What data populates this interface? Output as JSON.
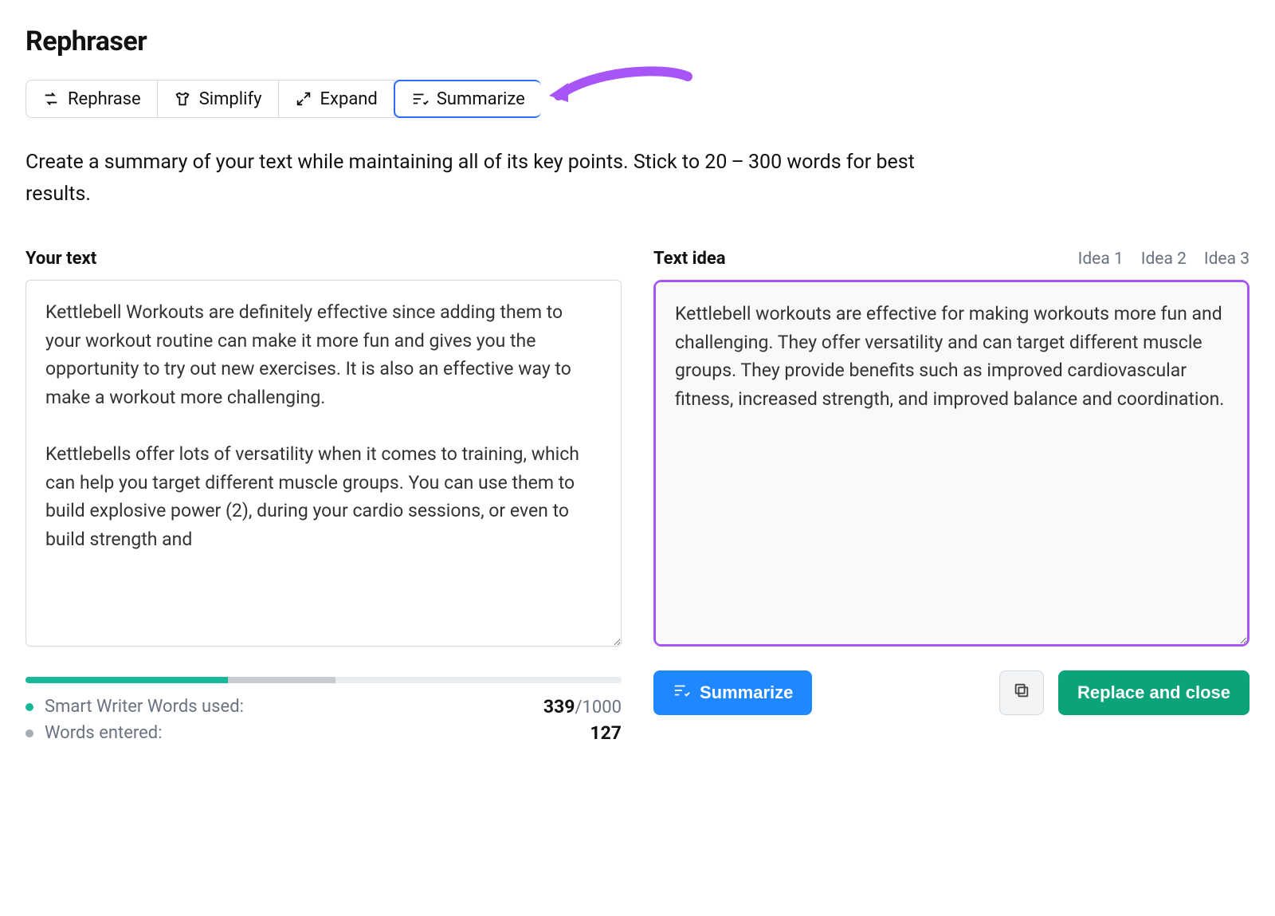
{
  "title": "Rephraser",
  "tabs": [
    {
      "label": "Rephrase",
      "icon": "rephrase-icon"
    },
    {
      "label": "Simplify",
      "icon": "shirt-icon"
    },
    {
      "label": "Expand",
      "icon": "expand-icon"
    },
    {
      "label": "Summarize",
      "icon": "summarize-icon"
    }
  ],
  "active_tab_index": 3,
  "description": "Create a summary of your text while maintaining all of its key points. Stick to 20 – 300 words for best results.",
  "left": {
    "label": "Your text",
    "value": "Kettlebell Workouts are definitely effective since adding them to your workout routine can make it more fun and gives you the opportunity to try out new exercises. It is also an effective way to make a workout more challenging.\n\nKettlebells offer lots of versatility when it comes to training, which can help you target different muscle groups. You can use them to build explosive power (2), during your cardio sessions, or even to build strength and"
  },
  "right": {
    "label": "Text idea",
    "idea_tabs": [
      "Idea 1",
      "Idea 2",
      "Idea 3"
    ],
    "value": "Kettlebell workouts are effective for making workouts more fun and challenging. They offer versatility and can target different muscle groups. They provide benefits such as improved cardiovascular fitness, increased strength, and improved balance and coordination."
  },
  "progress": {
    "green_pct": 34,
    "grey_pct": 18
  },
  "stats": {
    "words_used_label": "Smart Writer Words used:",
    "words_used": "339",
    "words_cap": "/1000",
    "words_entered_label": "Words entered:",
    "words_entered": "127"
  },
  "actions": {
    "summarize": "Summarize",
    "copy_icon": "copy-icon",
    "replace": "Replace and close"
  }
}
